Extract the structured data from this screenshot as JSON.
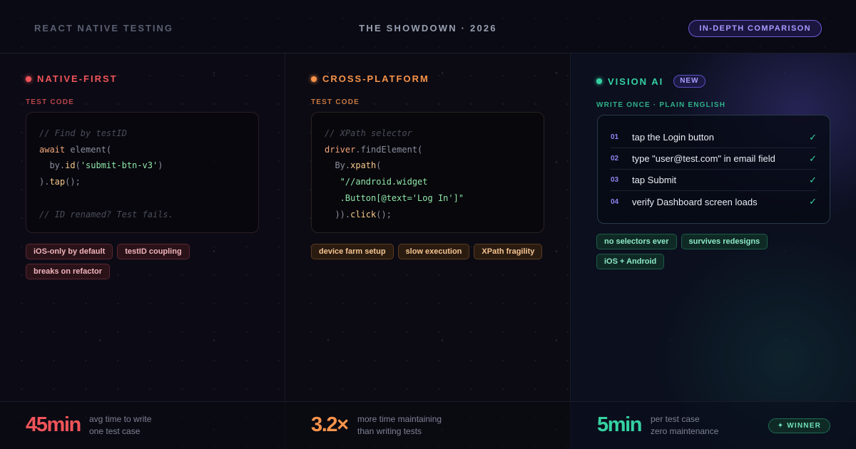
{
  "header": {
    "left": "REACT NATIVE TESTING",
    "center": "THE SHOWDOWN · 2026",
    "badge": "IN-DEPTH COMPARISON"
  },
  "columns": [
    {
      "title": "NATIVE-FIRST",
      "sub_label": "TEST CODE",
      "accent": "#f0545a",
      "tags": [
        "iOS-only by default",
        "testID coupling",
        "breaks on refactor"
      ],
      "stat": "45min",
      "stat_desc_1": "avg time to write",
      "stat_desc_2": "one test case"
    },
    {
      "title": "CROSS-PLATFORM",
      "sub_label": "TEST CODE",
      "accent": "#f7934a",
      "tags": [
        "device farm setup",
        "slow execution",
        "XPath fragility"
      ],
      "stat": "3.2×",
      "stat_desc_1": "more time maintaining",
      "stat_desc_2": "than writing tests"
    },
    {
      "title": "VISION AI",
      "badge": "NEW",
      "sub_label": "WRITE ONCE · PLAIN ENGLISH",
      "accent": "#35d1a2",
      "steps": [
        {
          "num": "01",
          "text": "tap the Login button"
        },
        {
          "num": "02",
          "text": "type \"user@test.com\" in email field"
        },
        {
          "num": "03",
          "text": "tap Submit"
        },
        {
          "num": "04",
          "text": "verify Dashboard screen loads"
        }
      ],
      "check": "✓",
      "tags": [
        "no selectors ever",
        "survives redesigns",
        "iOS + Android"
      ],
      "stat": "5min",
      "stat_desc_1": "per test case",
      "stat_desc_2": "zero maintenance",
      "winner": "✦ WINNER"
    }
  ],
  "code1": {
    "l1": "// Find by testID",
    "l2_kw": "await",
    "l2_rest": " element(",
    "l3_a": "  by.",
    "l3_fn": "id",
    "l3_b": "(",
    "l3_str": "'submit-btn-v3'",
    "l3_c": ")",
    "l4_a": ").",
    "l4_fn": "tap",
    "l4_b": "();",
    "l6": "// ID renamed? Test fails."
  },
  "code2": {
    "l1": "// XPath selector",
    "l2_kw": "driver",
    "l2_a": ".findElement(",
    "l3_a": "  By.",
    "l3_fn": "xpath",
    "l3_b": "(",
    "l4_str": "   \"//android.widget",
    "l5_str": "   .Button[@text='Log In']\"",
    "l6_a": "  )).",
    "l6_fn": "click",
    "l6_b": "();"
  }
}
